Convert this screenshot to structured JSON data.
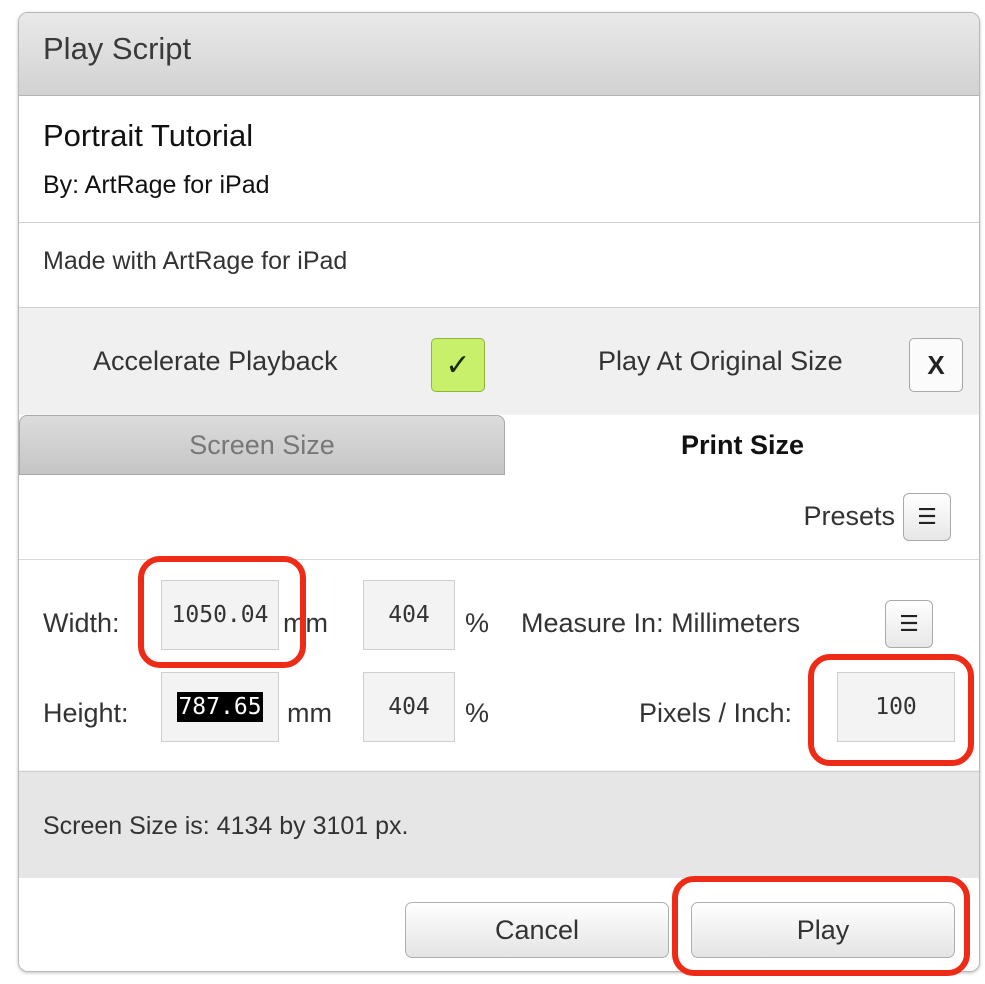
{
  "dialog": {
    "title": "Play Script",
    "script_name": "Portrait Tutorial",
    "author": "By: ArtRage for iPad",
    "description": "Made with ArtRage for iPad"
  },
  "options": {
    "accelerate_label": "Accelerate Playback",
    "accelerate_checked": true,
    "accelerate_mark": "✓",
    "original_size_label": "Play At Original Size",
    "original_size_checked": false,
    "original_size_mark": "X"
  },
  "tabs": [
    {
      "label": "Screen Size",
      "active": false
    },
    {
      "label": "Print Size",
      "active": true
    }
  ],
  "presets": {
    "label": "Presets",
    "icon": "list-menu-icon"
  },
  "size": {
    "width_label": "Width:",
    "width_value": "1050.04",
    "width_unit": "mm",
    "width_percent": "404",
    "height_label": "Height:",
    "height_value": "787.65",
    "height_unit": "mm",
    "height_percent": "404",
    "percent_sign": "%",
    "measure_label": "Measure In: Millimeters",
    "ppi_label": "Pixels / Inch:",
    "ppi_value": "100"
  },
  "status": {
    "text": "Screen Size is: 4134 by 3101 px."
  },
  "buttons": {
    "cancel": "Cancel",
    "play": "Play"
  },
  "highlight_color": "#ee2b16",
  "accent_check_color": "#c8f06a"
}
